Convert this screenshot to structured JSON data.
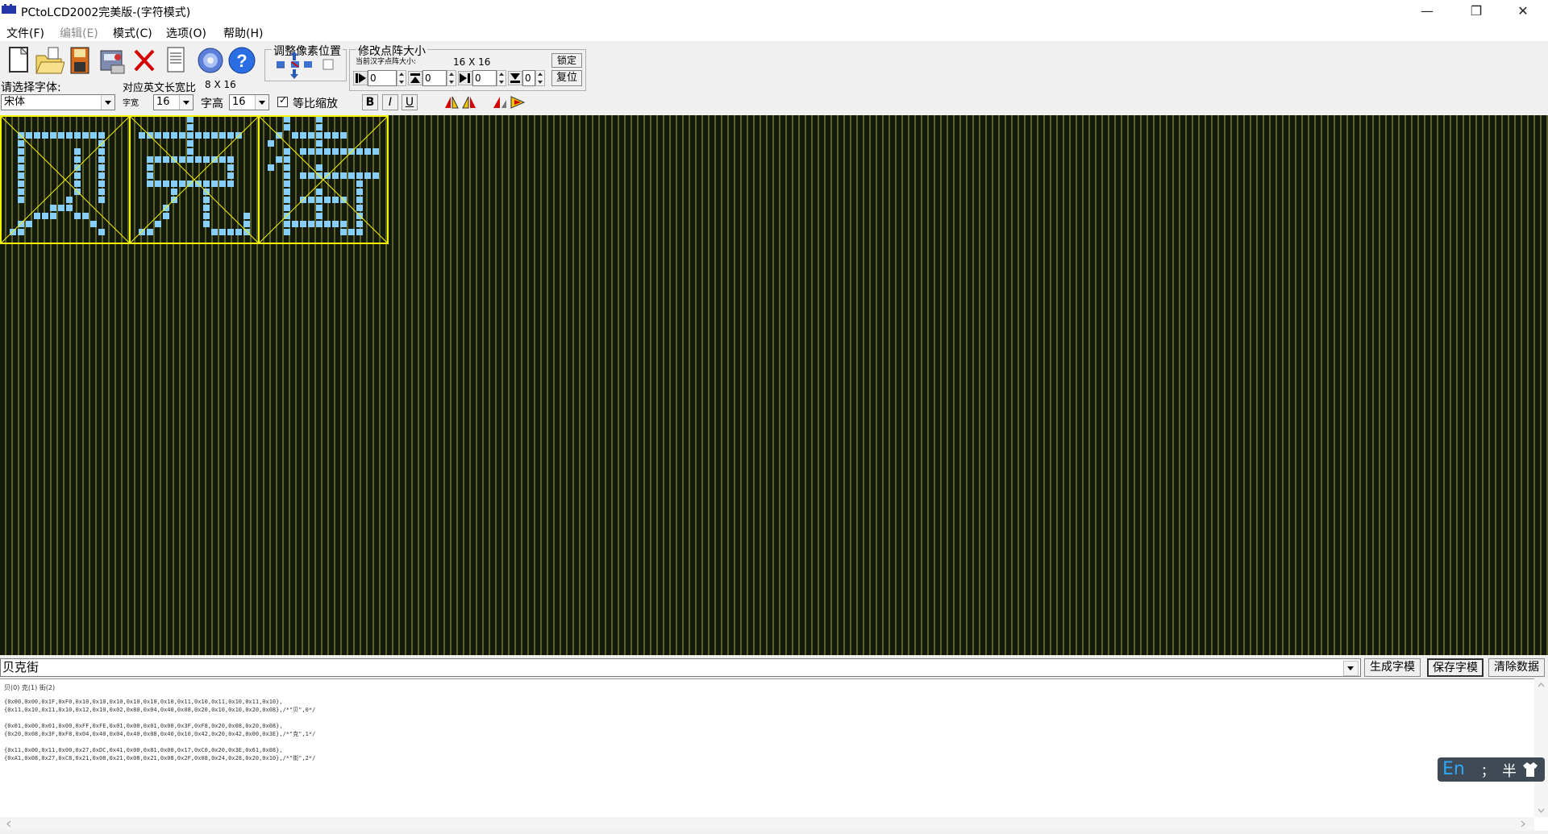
{
  "window": {
    "title": "PCtoLCD2002完美版-(字符模式)",
    "minimize": "—",
    "restore": "❐",
    "close": "✕"
  },
  "menu": [
    {
      "label": "文件(F)",
      "enabled": true
    },
    {
      "label": "编辑(E)",
      "enabled": false
    },
    {
      "label": "模式(C)",
      "enabled": true
    },
    {
      "label": "选项(O)",
      "enabled": true
    },
    {
      "label": "帮助(H)",
      "enabled": true
    }
  ],
  "toolbar": {
    "buttons": [
      "new-icon",
      "open-folder-icon",
      "save-icon",
      "export-icon",
      "delete-icon",
      "document-icon",
      "settings-gear-icon",
      "help-icon"
    ],
    "font_select_label": "请选择字体:",
    "font_value": "宋体",
    "ascii_ratio_label": "对应英文长宽比",
    "ascii_ratio_value": "8 X 16",
    "width_label": "字宽",
    "width_value": "16",
    "height_label": "字高",
    "height_value": "16",
    "proportional_label": "等比缩放",
    "proportional_checked": true,
    "bold": "B",
    "italic": "I",
    "underline": "U",
    "adjust_title": "调整像素位置",
    "resize_title": "修改点阵大小",
    "current_size_label": "当前汉字点阵大小:",
    "current_size_value": "16 X 16",
    "lock_button": "锁定",
    "reset_button": "复位",
    "spin_values": [
      "0",
      "0",
      "0",
      "0"
    ]
  },
  "colors": {
    "lit_pixel": "#87cefa",
    "cell_border": "#f5f500",
    "grid_line": "#5b5f2b",
    "grid_bg": "#13190b"
  },
  "glyphs": [
    {
      "char": "贝",
      "rows": [
        "0000000000000000",
        "0000000000000000",
        "0011111111111000",
        "0010000000001000",
        "0010000001001000",
        "0010000001001000",
        "0010000001001000",
        "0010000001001000",
        "0010000001001000",
        "0010000001001000",
        "0010000010001000",
        "0000001110000000",
        "0000111001100000",
        "0011000000010000",
        "0110000000001000",
        "0000000000000000"
      ]
    },
    {
      "char": "克",
      "rows": [
        "0000000100000000",
        "0000000100000000",
        "0111111111111100",
        "0000000100000000",
        "0000000100000000",
        "0011111111111000",
        "0010000000001000",
        "0010000000001000",
        "0011111111111000",
        "0000010001000000",
        "0000010001000000",
        "0000100001000000",
        "0000100001000010",
        "0001000001000010",
        "0110000000111110",
        "0000000000000000"
      ]
    },
    {
      "char": "街",
      "rows": [
        "0001000100000000",
        "0001000100000000",
        "0010111111100000",
        "0100000100000000",
        "0001011111111110",
        "0011000000000000",
        "0101000100000000",
        "0001011111111110",
        "0001000000001000",
        "0001000100001000",
        "0001011111101000",
        "0001000100001000",
        "0001000100001000",
        "0001111111101000",
        "0001000000111000",
        "0000000000000000"
      ]
    }
  ],
  "input_text": "贝克街",
  "actions": {
    "generate": "生成字模",
    "save": "保存字模",
    "clear": "清除数据"
  },
  "output": {
    "header": "贝(0) 克(1) 街(2)",
    "lines": [
      "{0x00,0x00,0x1F,0xF0,0x10,0x10,0x10,0x10,0x10,0x10,0x11,0x10,0x11,0x10,0x11,0x10},",
      "{0x11,0x10,0x11,0x10,0x12,0x10,0x02,0x80,0x04,0x40,0x08,0x20,0x10,0x10,0x20,0x08},/*\"贝\",0*/",
      "",
      "{0x01,0x00,0x01,0x00,0xFF,0xFE,0x01,0x00,0x01,0x00,0x3F,0xF8,0x20,0x08,0x20,0x08},",
      "{0x20,0x08,0x3F,0xF8,0x04,0x40,0x04,0x40,0x08,0x40,0x10,0x42,0x20,0x42,0x00,0x3E},/*\"克\",1*/",
      "",
      "{0x11,0x00,0x11,0x00,0x27,0xDC,0x41,0x00,0x81,0x00,0x17,0xC0,0x20,0x3E,0x61,0x08},",
      "{0xA1,0x08,0x27,0xC8,0x21,0x08,0x21,0x08,0x21,0x08,0x2F,0x08,0x24,0x28,0x20,0x10},/*\"街\",2*/"
    ]
  },
  "ime": {
    "mode": "En",
    "punct": "；",
    "width": "半",
    "skin_icon": "shirt-icon"
  }
}
